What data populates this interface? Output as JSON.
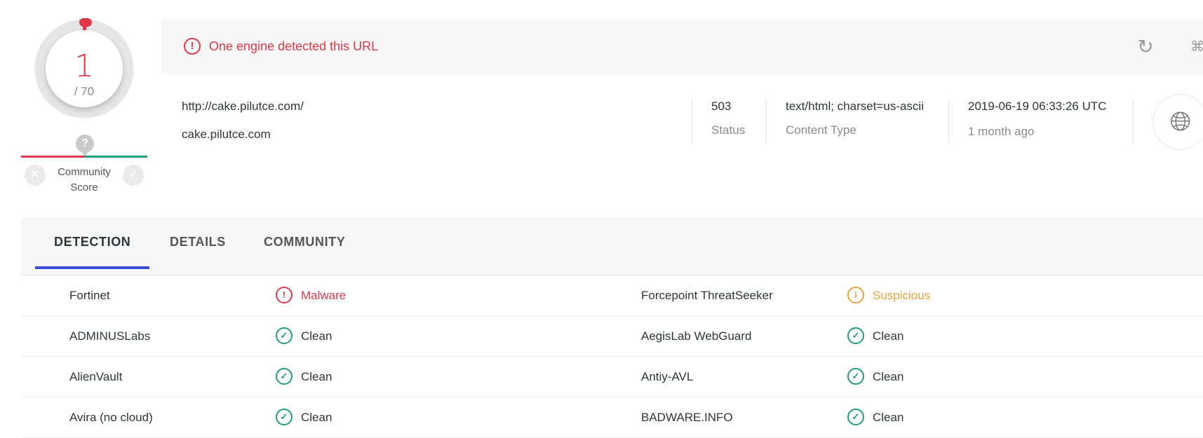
{
  "score": {
    "detections": "1",
    "total": "/ 70",
    "community_question": "?",
    "community_label_1": "Community",
    "community_label_2": "Score"
  },
  "alert": {
    "icon": "alert-circle-icon",
    "text": "One engine detected this URL"
  },
  "url_info": {
    "url": "http://cake.pilutce.com/",
    "domain": "cake.pilutce.com",
    "status_value": "503",
    "status_label": "Status",
    "content_type_value": "text/html; charset=us-ascii",
    "content_type_label": "Content Type",
    "date_value": "2019-06-19 06:33:26 UTC",
    "date_relative": "1 month ago"
  },
  "tabs": [
    {
      "label": "DETECTION"
    },
    {
      "label": "DETAILS"
    },
    {
      "label": "COMMUNITY"
    }
  ],
  "results": [
    {
      "left_engine": "Fortinet",
      "left_verdict": "Malware",
      "left_type": "malware",
      "right_engine": "Forcepoint ThreatSeeker",
      "right_verdict": "Suspicious",
      "right_type": "suspicious"
    },
    {
      "left_engine": "ADMINUSLabs",
      "left_verdict": "Clean",
      "left_type": "clean",
      "right_engine": "AegisLab WebGuard",
      "right_verdict": "Clean",
      "right_type": "clean"
    },
    {
      "left_engine": "AlienVault",
      "left_verdict": "Clean",
      "left_type": "clean",
      "right_engine": "Antiy-AVL",
      "right_verdict": "Clean",
      "right_type": "clean"
    },
    {
      "left_engine": "Avira (no cloud)",
      "left_verdict": "Clean",
      "left_type": "clean",
      "right_engine": "BADWARE.INFO",
      "right_verdict": "Clean",
      "right_type": "clean"
    }
  ],
  "colors": {
    "malicious": "#e03848",
    "suspicious": "#e8a33d",
    "clean": "#1f9e7a",
    "accent": "#3b4bd8"
  }
}
